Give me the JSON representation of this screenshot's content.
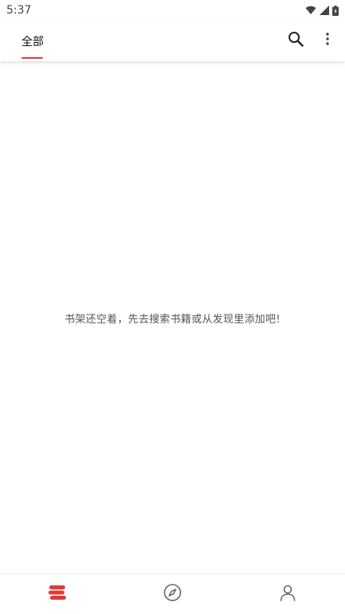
{
  "status_bar": {
    "time": "5:37",
    "icons": [
      "wifi-icon",
      "signal-icon",
      "battery-icon"
    ]
  },
  "top_bar": {
    "tabs": [
      {
        "label": "全部",
        "selected": true
      }
    ],
    "actions": [
      "search-icon",
      "more-vert-icon"
    ],
    "accent_color": "#e53935"
  },
  "main": {
    "empty_message": "书架还空着，先去搜索书籍或从发现里添加吧!"
  },
  "bottom_nav": {
    "items": [
      {
        "icon": "bookshelf-icon",
        "selected": true
      },
      {
        "icon": "explore-icon",
        "selected": false
      },
      {
        "icon": "profile-icon",
        "selected": false
      }
    ],
    "selected_color": "#e53935",
    "icon_color": "#666666"
  }
}
